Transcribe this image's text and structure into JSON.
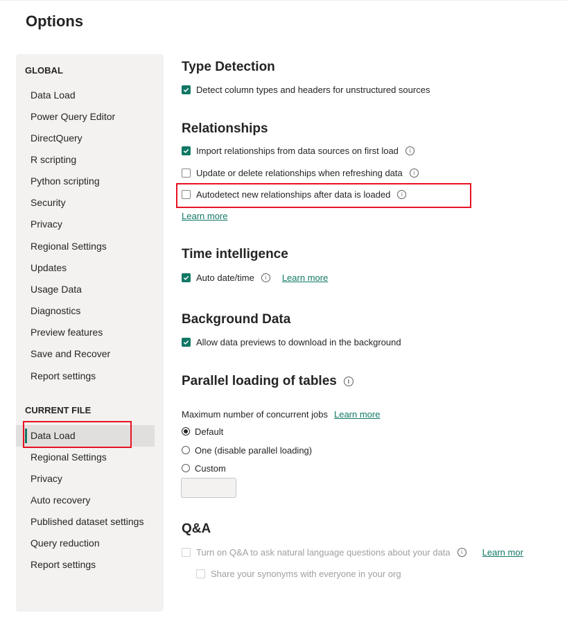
{
  "title": "Options",
  "sidebar": {
    "global_heading": "GLOBAL",
    "global_items": [
      {
        "label": "Data Load"
      },
      {
        "label": "Power Query Editor"
      },
      {
        "label": "DirectQuery"
      },
      {
        "label": "R scripting"
      },
      {
        "label": "Python scripting"
      },
      {
        "label": "Security"
      },
      {
        "label": "Privacy"
      },
      {
        "label": "Regional Settings"
      },
      {
        "label": "Updates"
      },
      {
        "label": "Usage Data"
      },
      {
        "label": "Diagnostics"
      },
      {
        "label": "Preview features"
      },
      {
        "label": "Save and Recover"
      },
      {
        "label": "Report settings"
      }
    ],
    "current_heading": "CURRENT FILE",
    "current_items": [
      {
        "label": "Data Load",
        "selected": true
      },
      {
        "label": "Regional Settings"
      },
      {
        "label": "Privacy"
      },
      {
        "label": "Auto recovery"
      },
      {
        "label": "Published dataset settings"
      },
      {
        "label": "Query reduction"
      },
      {
        "label": "Report settings"
      }
    ]
  },
  "type_detection": {
    "heading": "Type Detection",
    "detect_label": "Detect column types and headers for unstructured sources",
    "detect_checked": true
  },
  "relationships": {
    "heading": "Relationships",
    "import_label": "Import relationships from data sources on first load",
    "import_checked": true,
    "update_label": "Update or delete relationships when refreshing data",
    "update_checked": false,
    "autodetect_label": "Autodetect new relationships after data is loaded",
    "autodetect_checked": false,
    "learn_more": "Learn more"
  },
  "time_intelligence": {
    "heading": "Time intelligence",
    "auto_label": "Auto date/time",
    "auto_checked": true,
    "learn_more": "Learn more"
  },
  "background_data": {
    "heading": "Background Data",
    "allow_label": "Allow data previews to download in the background",
    "allow_checked": true
  },
  "parallel": {
    "heading": "Parallel loading of tables",
    "max_label": "Maximum number of concurrent jobs",
    "learn_more": "Learn more",
    "options": [
      "Default",
      "One (disable parallel loading)",
      "Custom"
    ],
    "selected": "Default",
    "custom_value": ""
  },
  "qna": {
    "heading": "Q&A",
    "turn_on_label": "Turn on Q&A to ask natural language questions about your data",
    "learn_more": "Learn mor",
    "share_label": "Share your synonyms with everyone in your org"
  },
  "colors": {
    "accent": "#117865",
    "highlight": "#e81123",
    "sidebar_bg": "#f3f2f1"
  }
}
